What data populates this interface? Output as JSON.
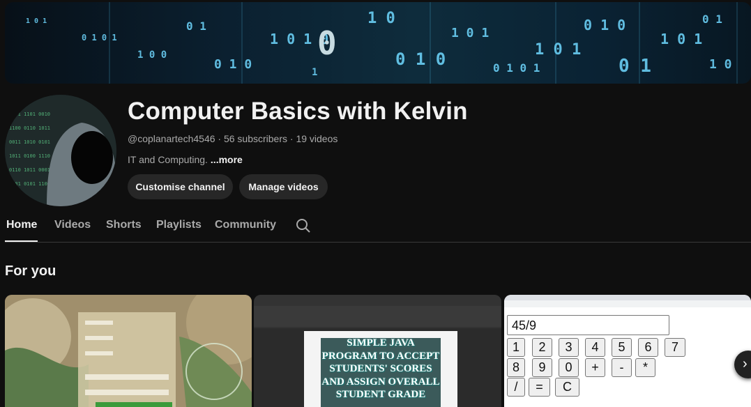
{
  "channel": {
    "title": "Computer Basics with Kelvin",
    "meta": "@coplanartech4546 · 56 subscribers · 19 videos",
    "description": "IT and Computing.",
    "more_label": "...more",
    "buttons": {
      "customise": "Customise channel",
      "manage": "Manage videos"
    }
  },
  "tabs": [
    {
      "label": "Home",
      "active": true
    },
    {
      "label": "Videos",
      "active": false
    },
    {
      "label": "Shorts",
      "active": false
    },
    {
      "label": "Playlists",
      "active": false
    },
    {
      "label": "Community",
      "active": false
    }
  ],
  "section": {
    "title": "For you"
  },
  "videos": [
    {
      "id": "v1"
    },
    {
      "id": "v2",
      "thumbnail_text": "SIMPLE JAVA PROGRAM TO ACCEPT STUDENTS' SCORES AND ASSIGN OVERALL STUDENT GRADE"
    },
    {
      "id": "v3",
      "calc_display": "45/9",
      "keys": [
        "1",
        "2",
        "3",
        "4",
        "5",
        "6",
        "7",
        "8",
        "9",
        "0",
        "+",
        "-",
        "*",
        "/",
        "=",
        "C"
      ]
    }
  ],
  "icons": {
    "search": "search-icon",
    "next": "chevron-right-icon"
  },
  "colors": {
    "background": "#0f0f0f",
    "button_bg": "#272727",
    "text_secondary": "#aaaaaa"
  }
}
